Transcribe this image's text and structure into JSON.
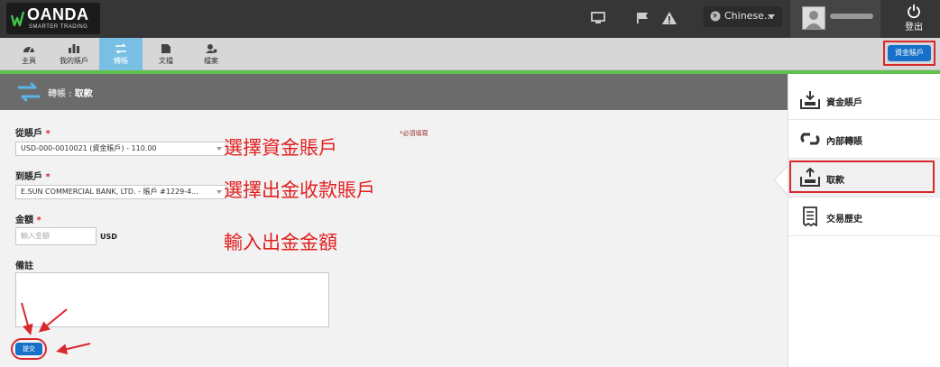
{
  "header": {
    "brand": "OANDA",
    "tagline": "SMARTER TRADING",
    "language": "Chinese...",
    "logout_label": "登出"
  },
  "nav": {
    "items": [
      {
        "label": "主頁",
        "icon": "dashboard-icon"
      },
      {
        "label": "我的賬戶",
        "icon": "bar-chart-icon"
      },
      {
        "label": "轉賬",
        "icon": "transfer-icon"
      },
      {
        "label": "文檔",
        "icon": "document-icon"
      },
      {
        "label": "檔案",
        "icon": "profile-icon"
      }
    ],
    "active_index": 2,
    "funds_button": "資金賬戶"
  },
  "title": {
    "prefix": "轉帳 : ",
    "page": "取款"
  },
  "form": {
    "from_label": "從賬戶",
    "from_value": "USD-000-0010021 (資金賬戶) - 110.00",
    "to_label": "到賬戶",
    "to_value": "E.SUN COMMERCIAL BANK, LTD. - 賬戶 #1229-4...",
    "amount_label": "金額",
    "amount_placeholder": "輸入金額",
    "currency": "USD",
    "notes_label": "備註",
    "required_note": "*必須填寫",
    "submit_label": "提交",
    "required_mark": "*"
  },
  "annotations": {
    "step1": "選擇資金賬戶",
    "step2": "選擇出金收款賬戶",
    "step3": "輸入出金金額",
    "color": "#e0201f"
  },
  "sidebar": {
    "items": [
      {
        "label": "資金賬戶",
        "icon": "inbox-download-icon"
      },
      {
        "label": "內部轉賬",
        "icon": "link-icon"
      },
      {
        "label": "取款",
        "icon": "inbox-upload-icon"
      },
      {
        "label": "交易歷史",
        "icon": "receipt-icon"
      }
    ],
    "selected_index": 2
  },
  "colors": {
    "accent_blue": "#1770c9",
    "highlight_red": "#d9272e",
    "green_bar": "#61c04b",
    "nav_active": "#78bfe3"
  }
}
